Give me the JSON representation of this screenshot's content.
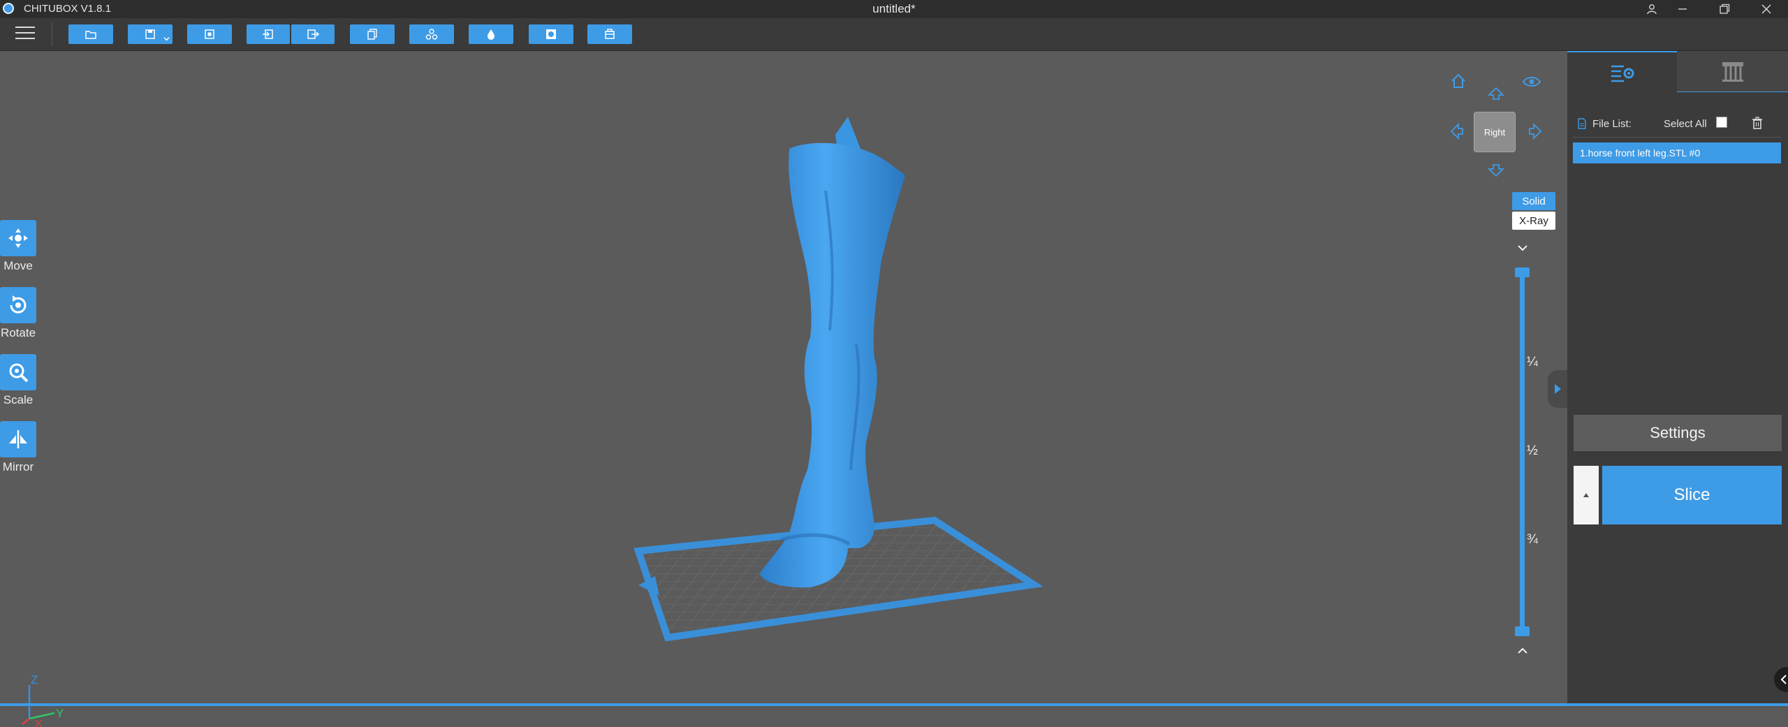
{
  "app": {
    "name": "CHITUBOX V1.8.1",
    "document_title": "untitled*"
  },
  "toolbar": {
    "buttons": [
      {
        "name": "open-file",
        "icon": "folder-icon"
      },
      {
        "name": "save",
        "icon": "save-icon",
        "has_dropdown": true
      },
      {
        "name": "fit-view",
        "icon": "frame-icon"
      },
      {
        "name": "import",
        "icon": "import-icon"
      },
      {
        "name": "export",
        "icon": "export-icon"
      },
      {
        "name": "copy",
        "icon": "copy-icon"
      },
      {
        "name": "arrange",
        "icon": "arrange-icon"
      },
      {
        "name": "hollow",
        "icon": "drop-icon"
      },
      {
        "name": "dig-hole",
        "icon": "hole-icon"
      },
      {
        "name": "supports",
        "icon": "box-icon"
      }
    ]
  },
  "sidetools": [
    {
      "label": "Move",
      "icon": "move-icon"
    },
    {
      "label": "Rotate",
      "icon": "rotate-icon"
    },
    {
      "label": "Scale",
      "icon": "scale-icon"
    },
    {
      "label": "Mirror",
      "icon": "mirror-icon"
    }
  ],
  "view": {
    "cube_face": "Right",
    "modes": [
      "Solid",
      "X-Ray"
    ],
    "active_mode": "Solid",
    "slider_fractions": [
      "¼",
      "½",
      "¾"
    ]
  },
  "axes": {
    "z": "Z",
    "x": "X",
    "y": "Y"
  },
  "panel": {
    "file_list_label": "File List:",
    "select_all_label": "Select All",
    "files": [
      "1.horse front left leg.STL #0"
    ],
    "settings_label": "Settings",
    "slice_label": "Slice"
  },
  "colors": {
    "accent": "#3e9be6",
    "model": "#3a96e2",
    "background": "#5b5b5b"
  }
}
